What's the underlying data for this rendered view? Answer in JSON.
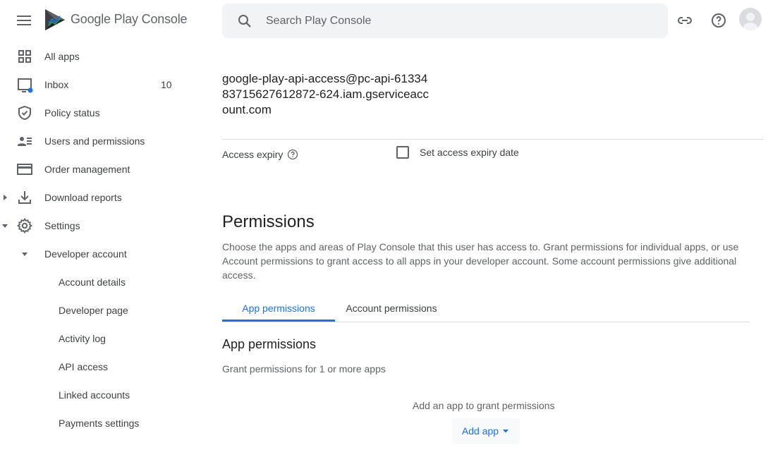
{
  "header": {
    "product_name": "Google Play Console",
    "search_placeholder": "Search Play Console",
    "icons": [
      "menu-icon",
      "play-console-logo",
      "search-icon",
      "link-icon",
      "help-icon",
      "avatar"
    ]
  },
  "sidebar": {
    "items": [
      {
        "label": "All apps",
        "icon": "grid-icon"
      },
      {
        "label": "Inbox",
        "icon": "inbox-icon",
        "count": "10"
      },
      {
        "label": "Policy status",
        "icon": "shield-icon"
      },
      {
        "label": "Users and permissions",
        "icon": "users-icon"
      },
      {
        "label": "Order management",
        "icon": "card-icon"
      },
      {
        "label": "Download reports",
        "icon": "download-icon"
      },
      {
        "label": "Settings",
        "icon": "gear-icon"
      },
      {
        "label": "Developer account"
      },
      {
        "label": "Account details"
      },
      {
        "label": "Developer page"
      },
      {
        "label": "Activity log"
      },
      {
        "label": "API access"
      },
      {
        "label": "Linked accounts"
      },
      {
        "label": "Payments settings"
      }
    ]
  },
  "main": {
    "email": "google-play-api-access@pc-api-6133483715627612872-624.iam.gserviceaccount.com",
    "access_expiry_label": "Access expiry",
    "set_expiry_label": "Set access expiry date",
    "permissions_title": "Permissions",
    "permissions_desc": "Choose the apps and areas of Play Console that this user has access to. Grant permissions for individual apps, or use Account permissions to grant access to all apps in your developer account. Some account permissions give additional access.",
    "tabs": [
      "App permissions",
      "Account permissions"
    ],
    "app_permissions_title": "App permissions",
    "app_permissions_sub": "Grant permissions for 1 or more apps",
    "add_hint": "Add an app to grant permissions",
    "add_app_label": "Add app"
  },
  "colors": {
    "accent": "#1a73e8",
    "text": "#202124",
    "secondary_text": "#5f6368",
    "search_bg": "#f1f3f4",
    "divider": "#dadce0"
  }
}
